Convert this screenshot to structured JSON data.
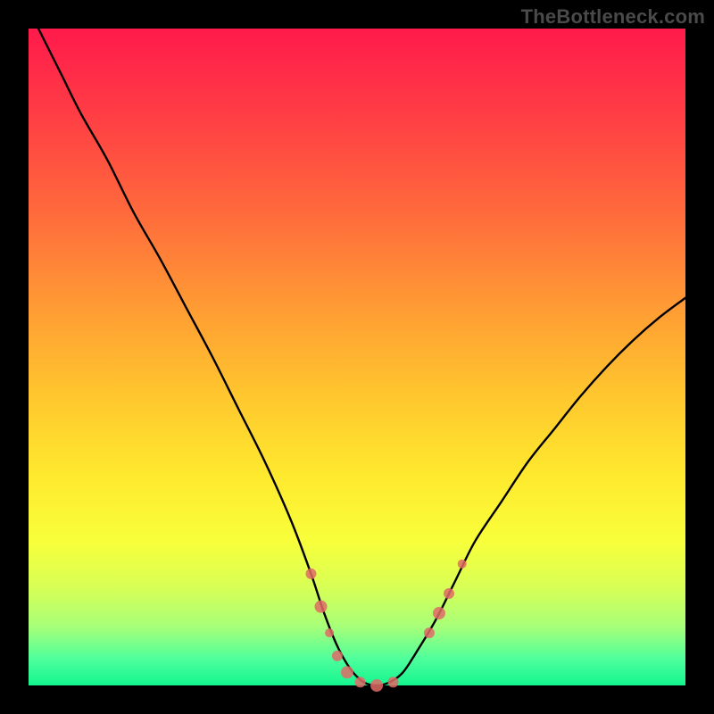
{
  "watermark": "TheBottleneck.com",
  "chart_data": {
    "type": "line",
    "title": "",
    "xlabel": "",
    "ylabel": "",
    "xlim": [
      0,
      100
    ],
    "ylim": [
      0,
      100
    ],
    "x": [
      0,
      2,
      5,
      8,
      12,
      16,
      20,
      24,
      28,
      32,
      36,
      40,
      43,
      45,
      47,
      49,
      51,
      53,
      55,
      57,
      59,
      62,
      65,
      68,
      72,
      76,
      80,
      84,
      88,
      92,
      96,
      100
    ],
    "series": [
      {
        "name": "bottleneck-curve",
        "values": [
          103,
          99,
          93,
          87,
          80,
          72,
          65,
          57.5,
          50,
          42,
          34,
          25,
          17,
          11,
          6,
          2.5,
          0.5,
          0,
          0.5,
          2,
          5,
          10,
          16,
          22,
          28,
          34,
          39,
          44,
          48.5,
          52.5,
          56,
          59
        ]
      }
    ],
    "markers": {
      "name": "highlight-dots",
      "color": "#e06a66",
      "points": [
        {
          "x": 43.0,
          "y": 17.0,
          "r": 6
        },
        {
          "x": 44.5,
          "y": 12.0,
          "r": 7
        },
        {
          "x": 45.8,
          "y": 8.0,
          "r": 5
        },
        {
          "x": 47.0,
          "y": 4.5,
          "r": 6
        },
        {
          "x": 48.5,
          "y": 2.0,
          "r": 7
        },
        {
          "x": 50.5,
          "y": 0.5,
          "r": 6
        },
        {
          "x": 53.0,
          "y": 0.0,
          "r": 7
        },
        {
          "x": 55.5,
          "y": 0.5,
          "r": 6
        },
        {
          "x": 61.0,
          "y": 8.0,
          "r": 6
        },
        {
          "x": 62.5,
          "y": 11.0,
          "r": 7
        },
        {
          "x": 64.0,
          "y": 14.0,
          "r": 6
        },
        {
          "x": 66.0,
          "y": 18.5,
          "r": 5
        }
      ]
    }
  }
}
